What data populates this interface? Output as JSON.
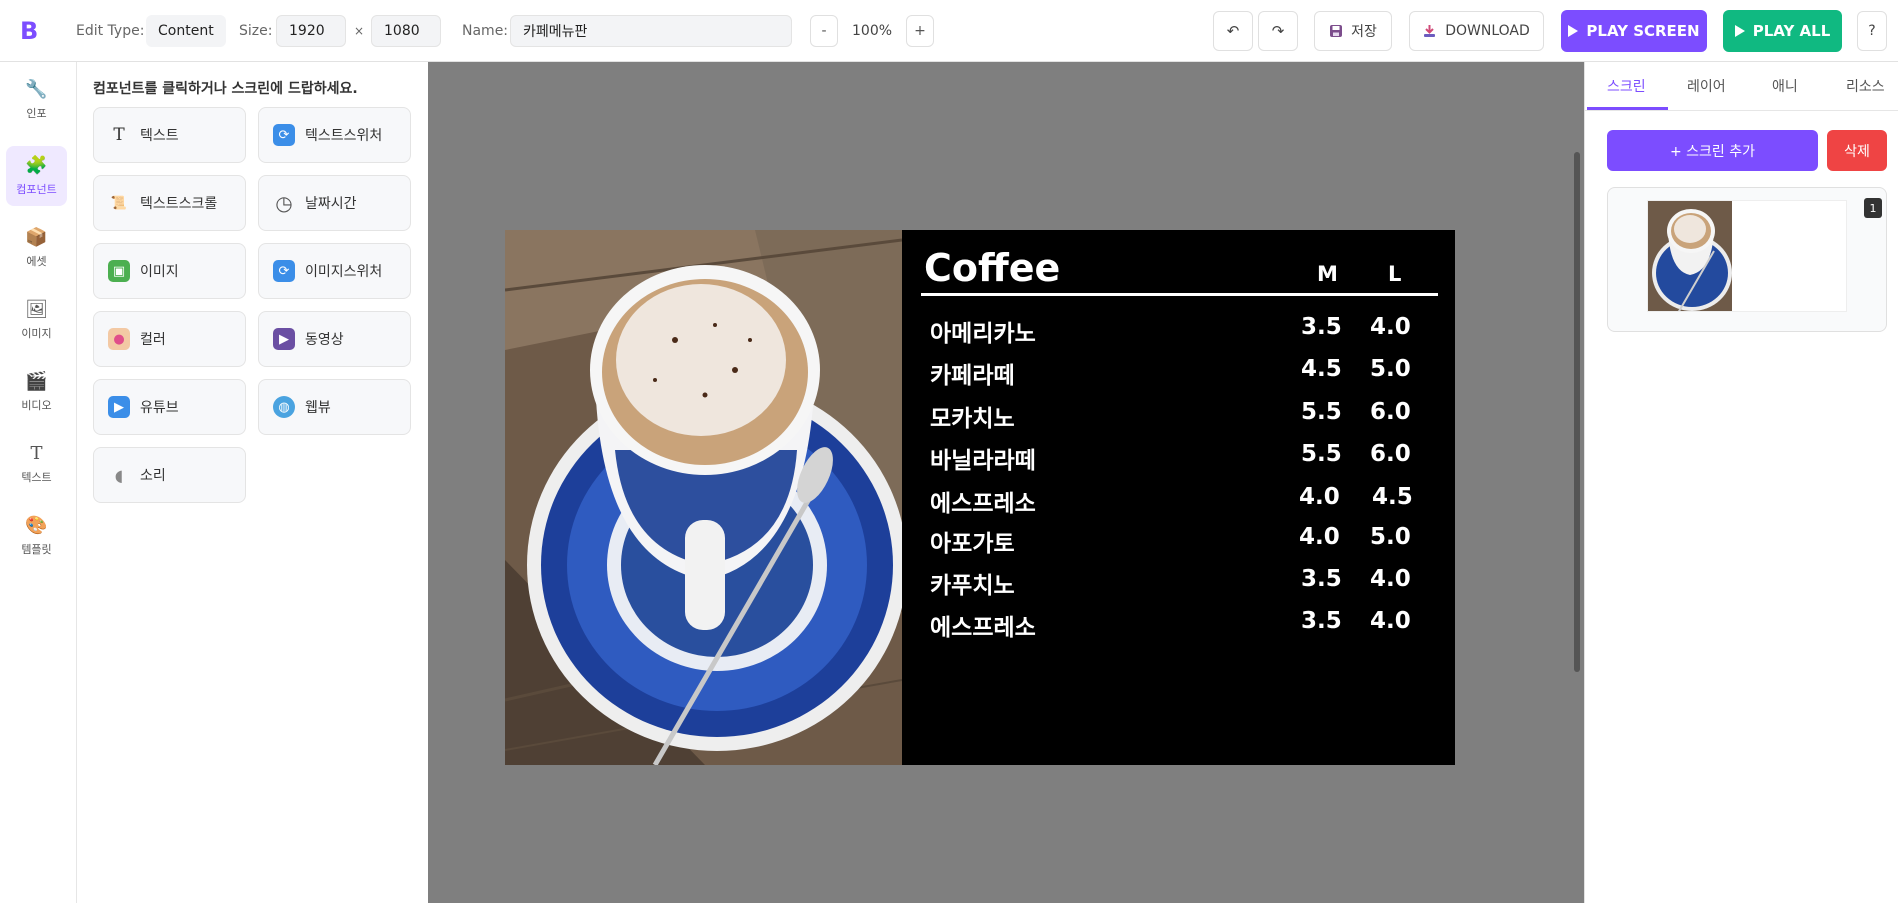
{
  "toolbar": {
    "logo": "B",
    "edit_type_label": "Edit Type:",
    "edit_type_value": "Content",
    "size_label": "Size:",
    "width": "1920",
    "size_x": "×",
    "height": "1080",
    "name_label": "Name:",
    "name_value": "카페메뉴판",
    "zoom_minus": "-",
    "zoom_value": "100%",
    "zoom_plus": "+",
    "undo": "↶",
    "redo": "↷",
    "save_label": "저장",
    "download_label": "DOWNLOAD",
    "play_screen_label": "PLAY SCREEN",
    "play_all_label": "PLAY ALL",
    "help": "?"
  },
  "leftnav": {
    "items": [
      {
        "label": "인포",
        "icon": "wrench-icon",
        "glyph": "🔧"
      },
      {
        "label": "컴포넌트",
        "icon": "puzzle-icon",
        "glyph": "🧩"
      },
      {
        "label": "에셋",
        "icon": "box-icon",
        "glyph": "📦"
      },
      {
        "label": "이미지",
        "icon": "image-icon",
        "glyph": "🖼"
      },
      {
        "label": "비디오",
        "icon": "clapper-icon",
        "glyph": "🎬"
      },
      {
        "label": "텍스트",
        "icon": "text-icon",
        "glyph": "T"
      },
      {
        "label": "템플릿",
        "icon": "palette-icon",
        "glyph": "🎨"
      }
    ]
  },
  "components": {
    "title": "컴포넌트를 클릭하거나 스크린에 드랍하세요.",
    "items": [
      {
        "label": "텍스트",
        "icon": "text-icon",
        "glyph": "T"
      },
      {
        "label": "텍스트스위처",
        "icon": "switch-icon",
        "glyph": "⟳"
      },
      {
        "label": "텍스트스크롤",
        "icon": "scroll-icon",
        "glyph": "📜"
      },
      {
        "label": "날짜시간",
        "icon": "clock-icon",
        "glyph": "◷"
      },
      {
        "label": "이미지",
        "icon": "image-icon",
        "glyph": "▣"
      },
      {
        "label": "이미지스위처",
        "icon": "switch-icon",
        "glyph": "⟳"
      },
      {
        "label": "컬러",
        "icon": "palette-icon",
        "glyph": "●"
      },
      {
        "label": "동영상",
        "icon": "clapper-icon",
        "glyph": "▶"
      },
      {
        "label": "유튜브",
        "icon": "play-icon",
        "glyph": "▶"
      },
      {
        "label": "웹뷰",
        "icon": "globe-icon",
        "glyph": "◍"
      },
      {
        "label": "소리",
        "icon": "speaker-icon",
        "glyph": "◖"
      }
    ]
  },
  "menu_board": {
    "title": "Coffee",
    "col_m": "M",
    "col_l": "L",
    "rows": [
      {
        "name": "아메리카노",
        "m": "3.5",
        "l": "4.0"
      },
      {
        "name": "카페라떼",
        "m": "4.5",
        "l": "5.0"
      },
      {
        "name": "모카치노",
        "m": "5.5",
        "l": "6.0"
      },
      {
        "name": "바닐라라떼",
        "m": "5.5",
        "l": "6.0"
      },
      {
        "name": "에스프레소",
        "m": "4.0",
        "l": "4.5"
      },
      {
        "name": "아포가토",
        "m": "4.0",
        "l": "5.0"
      },
      {
        "name": "카푸치노",
        "m": "3.5",
        "l": "4.0"
      },
      {
        "name": "에스프레소",
        "m": "3.5",
        "l": "4.0"
      }
    ]
  },
  "rightpanel": {
    "tabs": [
      "스크린",
      "레이어",
      "애니",
      "리소스"
    ],
    "add_screen_label": "+ 스크린 추가",
    "delete_label": "삭제",
    "screen_badge": "1"
  },
  "colors": {
    "accent": "#7c4dff",
    "play_all": "#10b981",
    "delete": "#ef4444",
    "canvas_bg": "#7f7f7f"
  }
}
